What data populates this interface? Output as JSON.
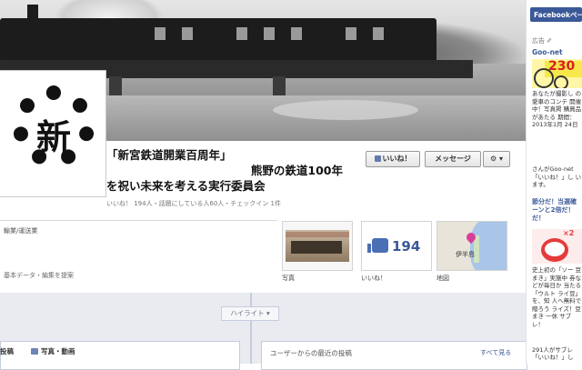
{
  "page": {
    "title_line1": "「新宮鉄道開業百周年」",
    "title_line2": "熊野の鉄道100年",
    "title_line3": "を祝い未来を考える実行委員会",
    "stats": "いいね！ 194人・話題にしている人60人・チェックイン 1件",
    "avatar_char": "新",
    "category": "輸業/運送業",
    "basic_data": "基本データ・編集を提案"
  },
  "actions": {
    "like": "いいね！",
    "message": "メッセージ",
    "gear": "⚙ ▾"
  },
  "tiles": {
    "photos_label": "写真",
    "likes_label": "いいね！",
    "likes_count": "194",
    "map_label": "地図",
    "map_place": "伊半島"
  },
  "timeline": {
    "highlight": "ハイライト ▾",
    "tab_post": "投稿",
    "tab_photo": "写真・動画",
    "recent_title": "ユーザーからの最近の投稿",
    "see_all": "すべて見る"
  },
  "sidebar": {
    "fb_bar": "Facebookペー",
    "ad_label": "広告 ✐",
    "ad1_title": "Goo-net",
    "ad1_number": "230",
    "ad1_text": "あなたが撮影し の愛車のコンテ 開催中！写真掲 購買品があたる 期間：2013年1月 24日",
    "ad1_like": "",
    "ad2_text": "さんがGoo-net 「いいね！」し います。",
    "ad3_title": "節分だ！当選確 ーンと2倍だ！ だ！",
    "ad3_badge": "×2",
    "ad3_text": "史上初の「ソー 豆まき」実施中 券などが毎日か 当たる「ウルト ライ豆」を、知 人へ無料で贈ろう ライズ！豆まき 一休 サブレ！",
    "ad3_like": "291人がサブレ 「いいね！」し"
  }
}
